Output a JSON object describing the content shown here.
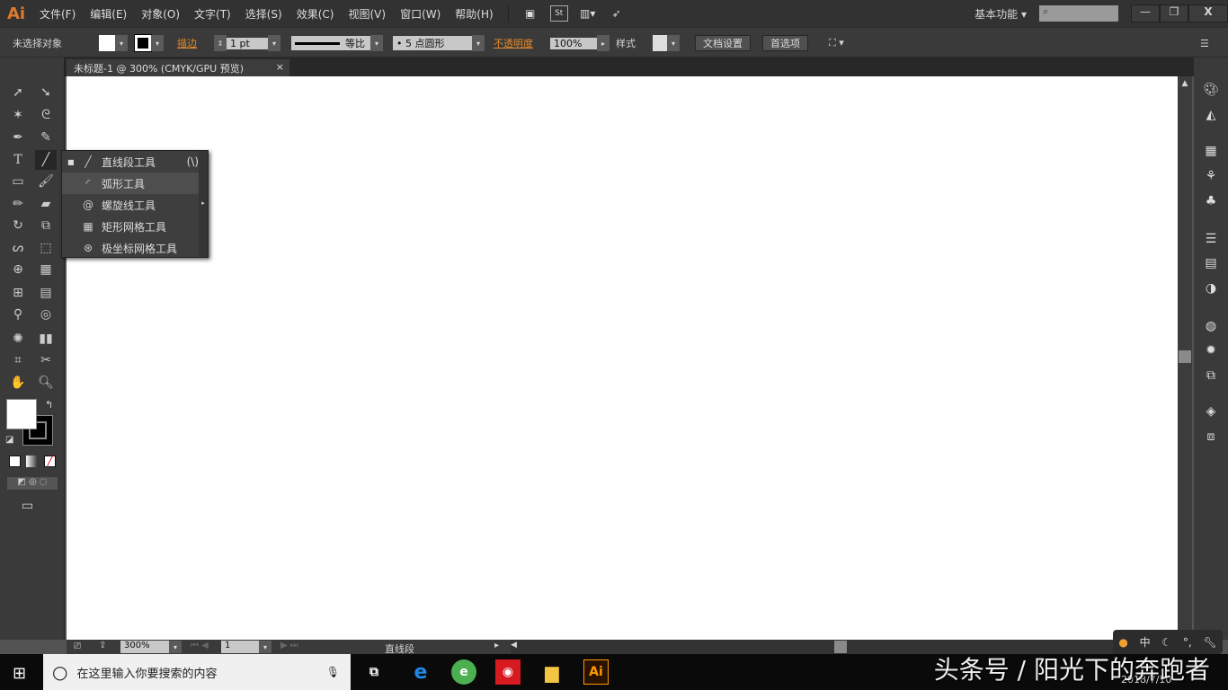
{
  "app": {
    "logo": "Ai",
    "workspace": "基本功能",
    "search_placeholder": ""
  },
  "menu": [
    "文件(F)",
    "编辑(E)",
    "对象(O)",
    "文字(T)",
    "选择(S)",
    "效果(C)",
    "视图(V)",
    "窗口(W)",
    "帮助(H)"
  ],
  "menu_icons": [
    "bridge-icon",
    "stock-icon",
    "arrange-documents-icon",
    "gpu-rocket-icon"
  ],
  "window_controls": {
    "minimize": "—",
    "restore": "❐",
    "close": "X"
  },
  "control": {
    "selection": "未选择对象",
    "stroke_label": "描边",
    "stroke_weight": "1 pt",
    "profile": "等比",
    "brush": "5 点圆形",
    "opacity_label": "不透明度",
    "opacity": "100%",
    "style_label": "样式",
    "doc_setup": "文档设置",
    "preferences": "首选项"
  },
  "document": {
    "tab_title": "未标题-1 @ 300% (CMYK/GPU 预览)",
    "close": "×"
  },
  "flyout": {
    "items": [
      {
        "label": "直线段工具",
        "shortcut": "(\\)",
        "icon": "line-segment-icon",
        "active": true
      },
      {
        "label": "弧形工具",
        "shortcut": "",
        "icon": "arc-icon",
        "active": false
      },
      {
        "label": "螺旋线工具",
        "shortcut": "",
        "icon": "spiral-icon",
        "active": false
      },
      {
        "label": "矩形网格工具",
        "shortcut": "",
        "icon": "rectangular-grid-icon",
        "active": false
      },
      {
        "label": "极坐标网格工具",
        "shortcut": "",
        "icon": "polar-grid-icon",
        "active": false
      }
    ]
  },
  "status": {
    "zoom": "300%",
    "artboard": "1",
    "current_tool": "直线段"
  },
  "taskbar": {
    "search_placeholder": "在这里输入你要搜索的内容",
    "date": "2018/7/10",
    "ime": "中",
    "ai": "Ai"
  },
  "watermark": "头条号 / 阳光下的奔跑者",
  "colors": {
    "accent": "#e08a2c",
    "fill": "#ffffff",
    "stroke": "#000000"
  }
}
